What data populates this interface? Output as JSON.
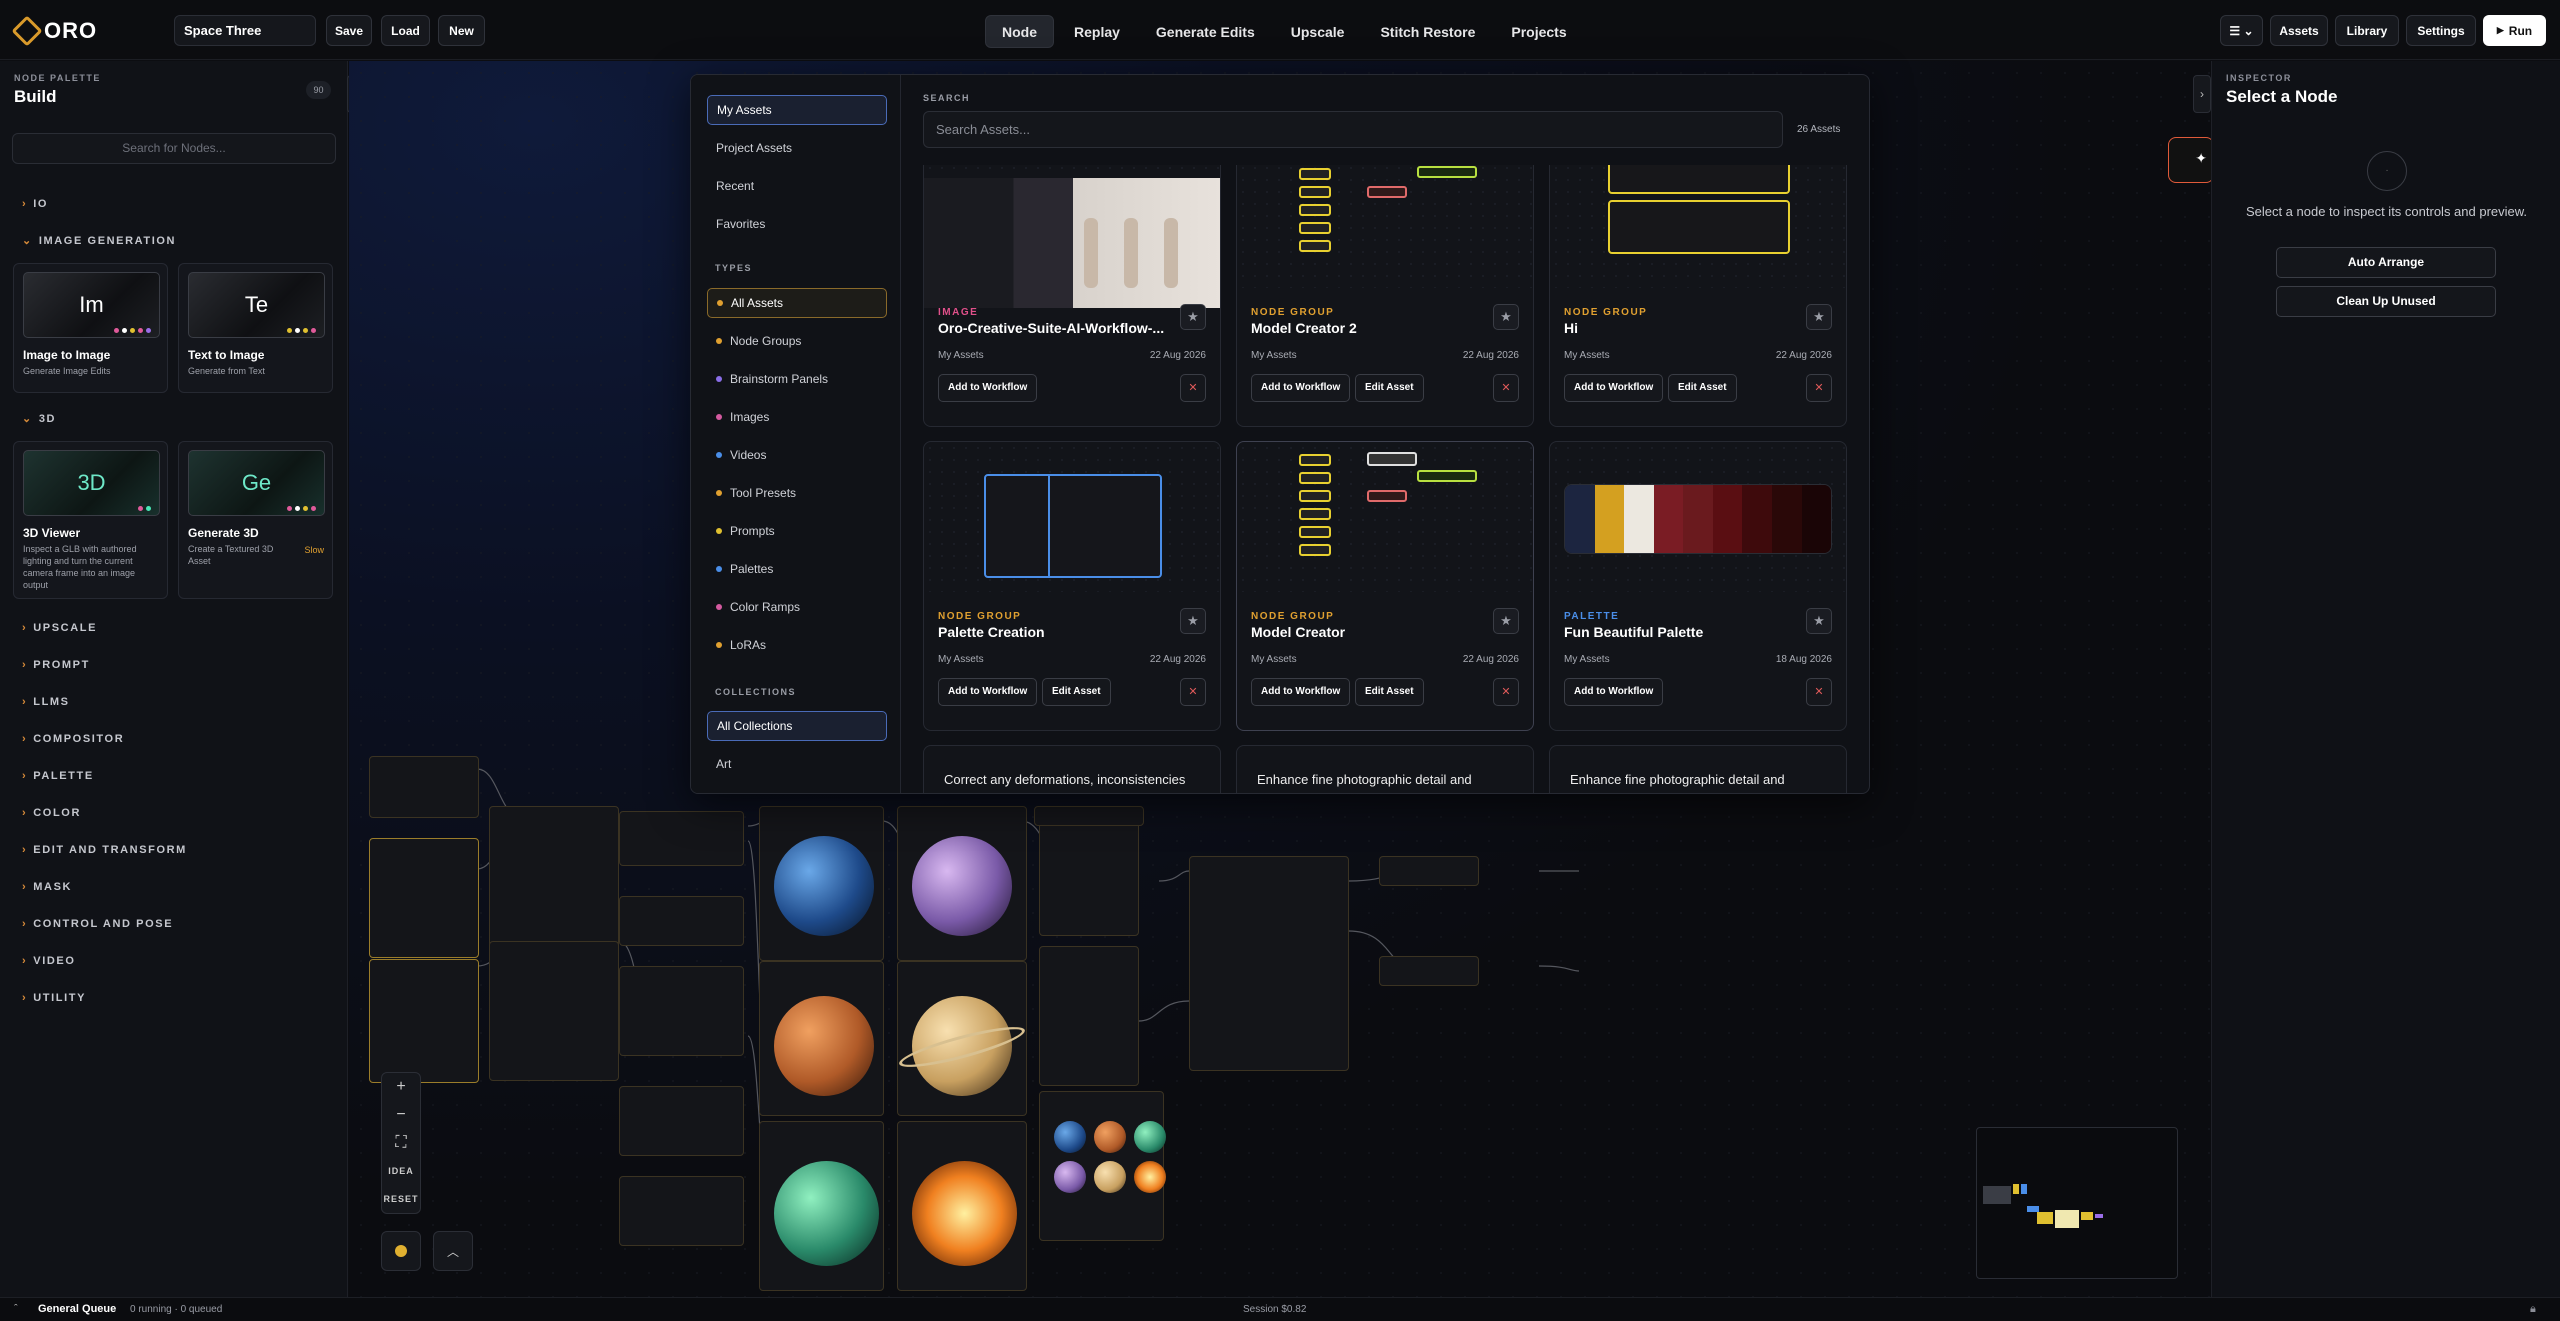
{
  "app": {
    "logo": "ORO"
  },
  "toolbar": {
    "project_name": "Space Three",
    "save": "Save",
    "load": "Load",
    "new": "New",
    "run": "Run",
    "run_icon": "play-icon"
  },
  "nav": {
    "tabs": [
      "Node",
      "Replay",
      "Generate Edits",
      "Upscale",
      "Stitch Restore",
      "Projects"
    ],
    "active": "Node"
  },
  "right_nav": {
    "assets": "Assets",
    "library": "Library",
    "settings": "Settings"
  },
  "palette": {
    "caption": "NODE PALETTE",
    "title": "Build",
    "count": "90",
    "search_placeholder": "Search for Nodes...",
    "categories": [
      "IO",
      "IMAGE GENERATION",
      "3D",
      "UPSCALE",
      "PROMPT",
      "LLMS",
      "COMPOSITOR",
      "PALETTE",
      "COLOR",
      "EDIT AND TRANSFORM",
      "MASK",
      "CONTROL AND POSE",
      "VIDEO",
      "UTILITY"
    ],
    "image_gen_cards": [
      {
        "abbr": "Im",
        "title": "Image to Image",
        "desc": "Generate Image Edits"
      },
      {
        "abbr": "Te",
        "title": "Text to Image",
        "desc": "Generate from Text"
      }
    ],
    "three_d_cards": [
      {
        "abbr": "3D",
        "title": "3D Viewer",
        "desc": "Inspect a GLB with authored lighting and turn the current camera frame into an image output"
      },
      {
        "abbr": "Ge",
        "title": "Generate 3D",
        "desc": "Create a Textured 3D Asset",
        "badge": "Slow"
      }
    ]
  },
  "inspector": {
    "caption": "INSPECTOR",
    "title": "Select a Node",
    "message": "Select a node to inspect its controls and preview.",
    "auto_arrange": "Auto Arrange",
    "clean_up": "Clean Up Unused"
  },
  "assets_modal": {
    "sidebar": {
      "sources": [
        "My Assets",
        "Project Assets",
        "Recent",
        "Favorites"
      ],
      "types_heading": "TYPES",
      "types": [
        {
          "label": "All Assets",
          "color": "#e0a030"
        },
        {
          "label": "Node Groups",
          "color": "#e0a030"
        },
        {
          "label": "Brainstorm Panels",
          "color": "#8a6ee8"
        },
        {
          "label": "Images",
          "color": "#d45aa0"
        },
        {
          "label": "Videos",
          "color": "#4a8ee8"
        },
        {
          "label": "Tool Presets",
          "color": "#e0a030"
        },
        {
          "label": "Prompts",
          "color": "#e0c030"
        },
        {
          "label": "Palettes",
          "color": "#4a8ee8"
        },
        {
          "label": "Color Ramps",
          "color": "#d45aa0"
        },
        {
          "label": "LoRAs",
          "color": "#e0a030"
        }
      ],
      "collections_heading": "COLLECTIONS",
      "collections": [
        "All Collections",
        "Art"
      ]
    },
    "search_caption": "SEARCH",
    "search_placeholder": "Search Assets...",
    "count": "26 Assets",
    "cards": [
      {
        "kind": "IMAGE",
        "kind_color": "#e0508a",
        "name": "Oro-Creative-Suite-AI-Workflow-...",
        "owner": "My Assets",
        "date": "22 Aug 2026",
        "buttons": [
          "Add to Workflow"
        ]
      },
      {
        "kind": "NODE GROUP",
        "kind_color": "#e0a030",
        "name": "Model Creator 2",
        "owner": "My Assets",
        "date": "22 Aug 2026",
        "buttons": [
          "Add to Workflow",
          "Edit Asset"
        ]
      },
      {
        "kind": "NODE GROUP",
        "kind_color": "#e0a030",
        "name": "Hi",
        "owner": "My Assets",
        "date": "22 Aug 2026",
        "buttons": [
          "Add to Workflow",
          "Edit Asset"
        ]
      },
      {
        "kind": "NODE GROUP",
        "kind_color": "#e0a030",
        "name": "Palette Creation",
        "owner": "My Assets",
        "date": "22 Aug 2026",
        "buttons": [
          "Add to Workflow",
          "Edit Asset"
        ]
      },
      {
        "kind": "NODE GROUP",
        "kind_color": "#e0a030",
        "name": "Model Creator",
        "owner": "My Assets",
        "date": "22 Aug 2026",
        "buttons": [
          "Add to Workflow",
          "Edit Asset"
        ]
      },
      {
        "kind": "PALETTE",
        "kind_color": "#4a8ee8",
        "name": "Fun Beautiful Palette",
        "owner": "My Assets",
        "date": "18 Aug 2026",
        "buttons": [
          "Add to Workflow"
        ]
      }
    ],
    "partial_cards": [
      "Correct any deformations, inconsistencies",
      "Enhance fine photographic detail and",
      "Enhance fine photographic detail and"
    ],
    "palette_swatches": [
      "#1c2540",
      "#d4a020",
      "#ece8e0",
      "#7a1c24",
      "#6a1a1e",
      "#5a0e12",
      "#3e0a0c",
      "#2a0808",
      "#1a0506"
    ]
  },
  "canvas": {
    "zoom_controls": [
      "+",
      "−",
      "⛶",
      "IDEA",
      "RESET"
    ]
  },
  "status": {
    "queue": "General Queue",
    "queue_detail": "0 running · 0 queued",
    "session": "Session $0.82"
  }
}
